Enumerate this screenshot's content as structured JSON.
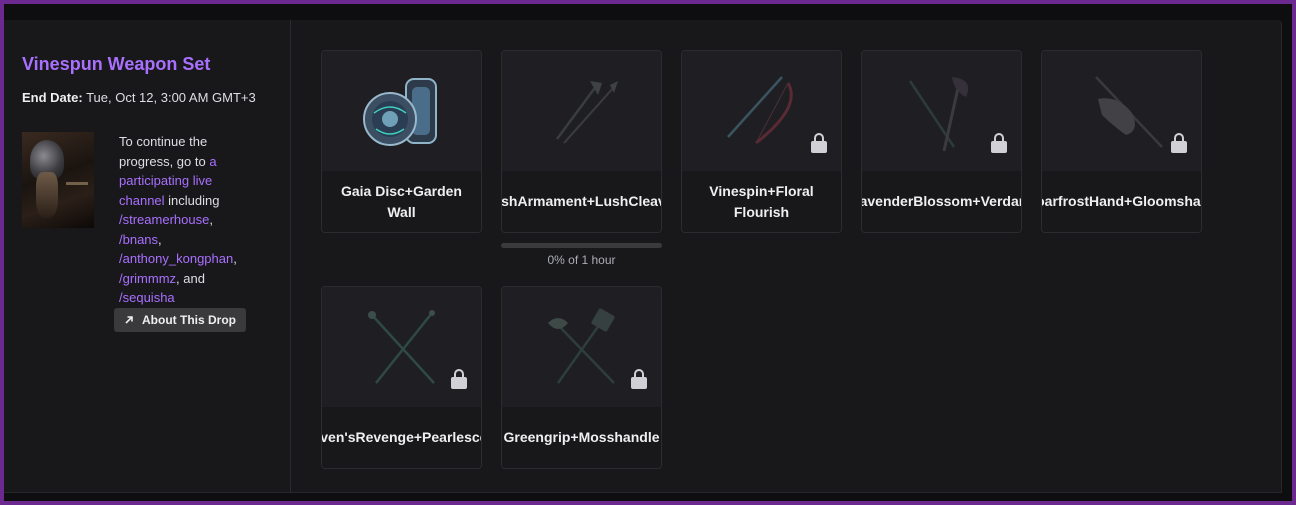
{
  "campaign": {
    "title": "Vinespun Weapon Set",
    "end_date_label": "End Date:",
    "end_date_value": "Tue, Oct 12, 3:00 AM GMT+3",
    "description": {
      "prefix": "To continue the progress, go to ",
      "link_text": "a participating live channel",
      "middle": " including ",
      "channels": [
        "/streamerhouse",
        "/bnans",
        "/anthony_kongphan",
        "/grimmmz",
        "/sequisha"
      ],
      "separator": ", ",
      "and_text": ", and "
    },
    "about_button": "About This Drop"
  },
  "rewards": [
    {
      "name": "Gaia Disc+Garden Wall",
      "locked": false,
      "icon": "shield-icon"
    },
    {
      "name": "LushArmament+LushCleaver",
      "locked": false,
      "icon": "axe-spear-icon",
      "progress_percent": 0,
      "progress_text": "0% of 1 hour"
    },
    {
      "name": "Vinespin+Floral Flourish",
      "locked": true,
      "icon": "sword-bow-icon"
    },
    {
      "name": "LavenderBlossom+Verdant",
      "locked": true,
      "icon": "rapier-hatchet-icon"
    },
    {
      "name": "HoarfrostHand+Gloomshade",
      "locked": true,
      "icon": "gauntlet-staff-icon"
    },
    {
      "name": "Raven'sRevenge+Pearlescent",
      "locked": true,
      "icon": "crossed-staffs-icon"
    },
    {
      "name": "Greengrip+Mosshandle",
      "locked": true,
      "icon": "crossed-hammers-icon"
    }
  ],
  "colors": {
    "accent": "#a970ff",
    "frame": "#6c2a91",
    "background": "#18181b"
  }
}
